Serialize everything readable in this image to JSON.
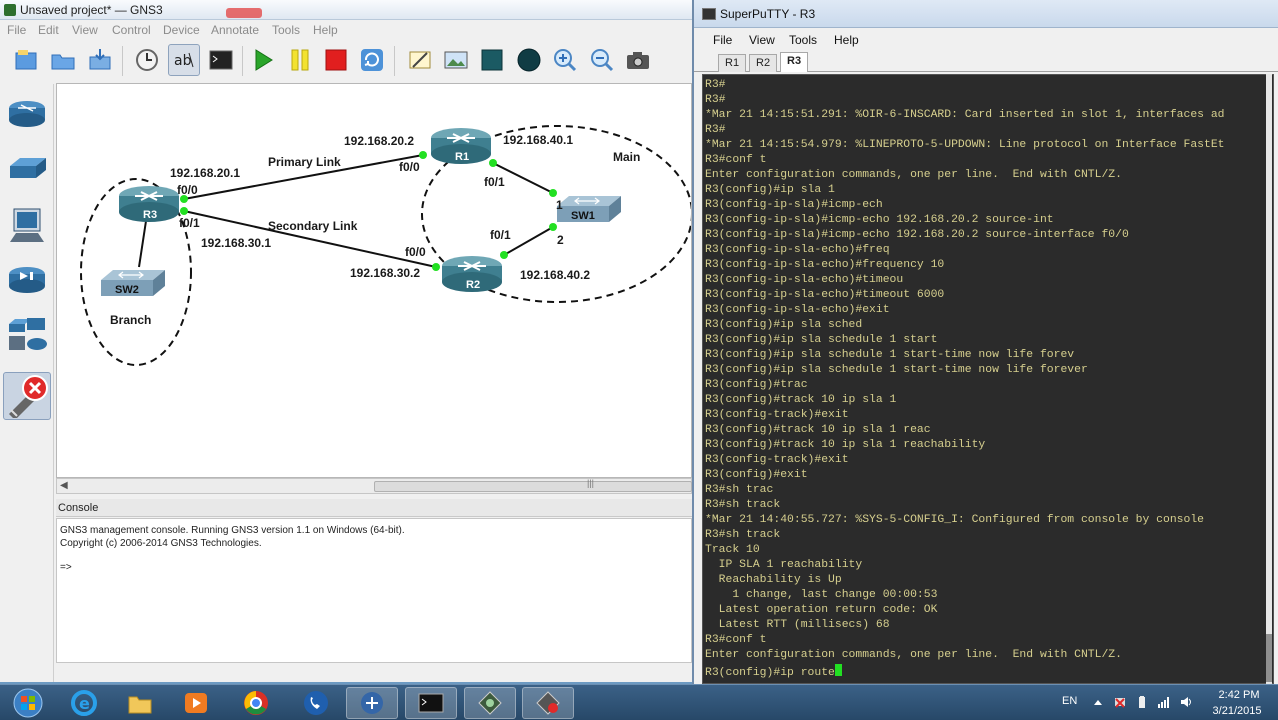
{
  "gns3": {
    "title": "Unsaved project* — GNS3",
    "menu": [
      "File",
      "Edit",
      "View",
      "Control",
      "Device",
      "Annotate",
      "Tools",
      "Help"
    ],
    "topology": {
      "devices": [
        "R1",
        "R2",
        "R3",
        "SW1",
        "SW2"
      ],
      "links": {
        "primary": "Primary Link",
        "secondary": "Secondary Link"
      },
      "areas": {
        "main": "Main",
        "branch": "Branch"
      },
      "addresses": {
        "r3_f00": "192.168.20.1",
        "r1_f00": "192.168.20.2",
        "r3_f01": "192.168.30.1",
        "r2_f00": "192.168.30.2",
        "r1_f01": "192.168.40.1",
        "r2_f01": "192.168.40.2"
      },
      "interfaces": {
        "r3_a": "f0/0",
        "r3_b": "f0/1",
        "r1_a": "f0/0",
        "r1_b": "f0/1",
        "r2_a": "f0/0",
        "r2_b": "f0/1",
        "sw1_1": "1",
        "sw1_2": "2"
      }
    },
    "console": {
      "title": "Console",
      "lines": [
        "GNS3 management console. Running GNS3 version 1.1 on Windows (64-bit).",
        "Copyright (c) 2006-2014 GNS3 Technologies.",
        "",
        "=>"
      ]
    }
  },
  "putty": {
    "title": "SuperPuTTY - R3",
    "menu": [
      "File",
      "View",
      "Tools",
      "Help"
    ],
    "tabs": [
      "R1",
      "R2",
      "R3"
    ],
    "active_tab": "R3",
    "terminal_lines": [
      "R3#",
      "R3#",
      "*Mar 21 14:15:51.291: %OIR-6-INSCARD: Card inserted in slot 1, interfaces ad",
      "R3#",
      "*Mar 21 14:15:54.979: %LINEPROTO-5-UPDOWN: Line protocol on Interface FastEt",
      "R3#conf t",
      "Enter configuration commands, one per line.  End with CNTL/Z.",
      "R3(config)#ip sla 1",
      "R3(config-ip-sla)#icmp-ech",
      "R3(config-ip-sla)#icmp-echo 192.168.20.2 source-int",
      "R3(config-ip-sla)#icmp-echo 192.168.20.2 source-interface f0/0",
      "R3(config-ip-sla-echo)#freq",
      "R3(config-ip-sla-echo)#frequency 10",
      "R3(config-ip-sla-echo)#timeou",
      "R3(config-ip-sla-echo)#timeout 6000",
      "R3(config-ip-sla-echo)#exit",
      "R3(config)#ip sla sched",
      "R3(config)#ip sla schedule 1 start",
      "R3(config)#ip sla schedule 1 start-time now life forev",
      "R3(config)#ip sla schedule 1 start-time now life forever",
      "R3(config)#trac",
      "R3(config)#track 10 ip sla 1",
      "R3(config-track)#exit",
      "R3(config)#track 10 ip sla 1 reac",
      "R3(config)#track 10 ip sla 1 reachability",
      "R3(config-track)#exit",
      "R3(config)#exit",
      "R3#sh trac",
      "R3#sh track",
      "*Mar 21 14:40:55.727: %SYS-5-CONFIG_I: Configured from console by console",
      "R3#sh track",
      "Track 10",
      "  IP SLA 1 reachability",
      "  Reachability is Up",
      "    1 change, last change 00:00:53",
      "  Latest operation return code: OK",
      "  Latest RTT (millisecs) 68",
      "R3#conf t",
      "Enter configuration commands, one per line.  End with CNTL/Z.",
      "R3(config)#ip route"
    ]
  },
  "taskbar": {
    "language": "EN",
    "time": "2:42 PM",
    "date": "3/21/2015"
  },
  "icons": {
    "toolbar": [
      "new-project-icon",
      "open-project-icon",
      "save-project-icon",
      "snapshot-icon",
      "show-interface-labels-icon",
      "console-all-icon",
      "start-icon",
      "suspend-icon",
      "stop-icon",
      "reload-icon",
      "add-note-icon",
      "insert-picture-icon",
      "draw-rectangle-icon",
      "draw-ellipse-icon",
      "zoom-in-icon",
      "zoom-out-icon",
      "screenshot-icon"
    ],
    "dock": [
      "routers-icon",
      "switches-icon",
      "end-devices-icon",
      "security-devices-icon",
      "all-devices-icon",
      "add-link-icon"
    ]
  },
  "colors": {
    "terminal_text": "#d6cf8e",
    "terminal_bg": "#2b2b2b",
    "link_up": "#22e022",
    "taskbar": "#2f557b"
  }
}
